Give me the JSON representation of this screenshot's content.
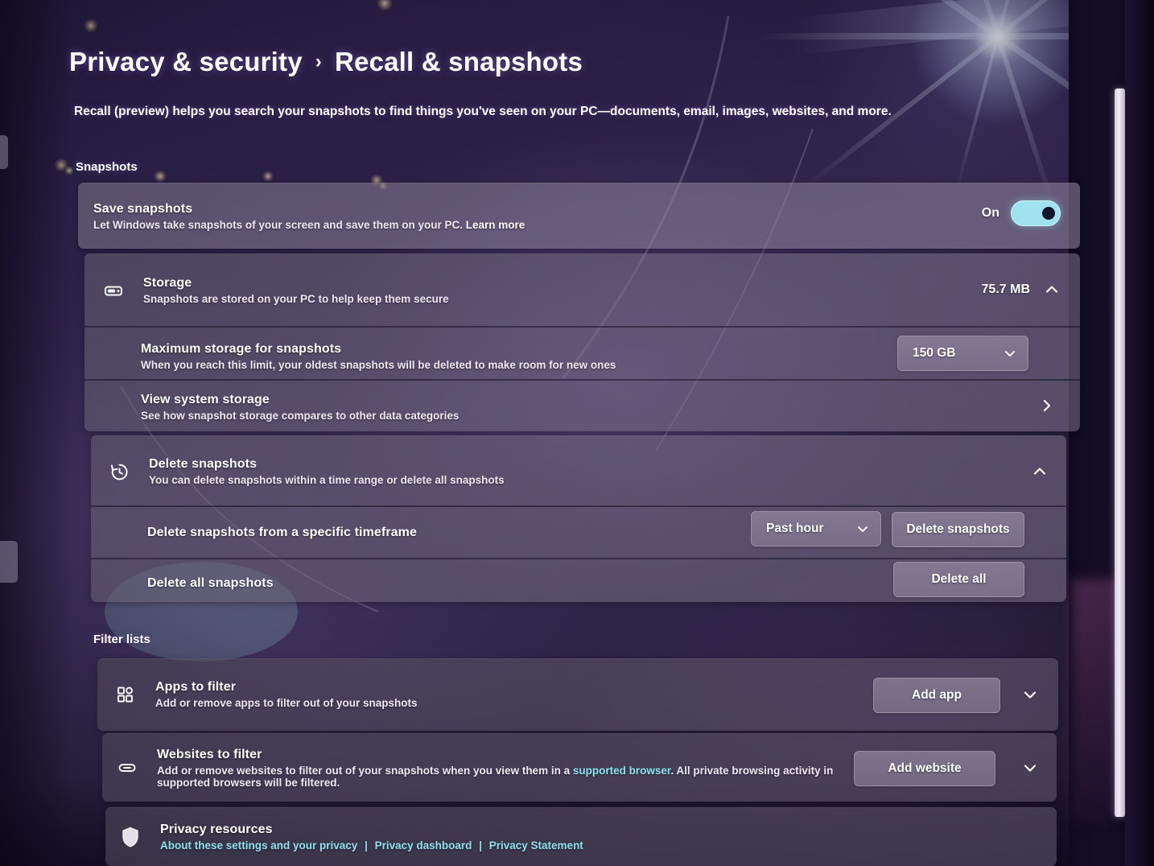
{
  "breadcrumb": {
    "parent": "Privacy & security",
    "separator": "›",
    "current": "Recall & snapshots"
  },
  "page": {
    "description": "Recall (preview) helps you search your snapshots to find things you've seen on your PC—documents, email, images, websites, and more."
  },
  "sections": {
    "snapshots_heading": "Snapshots",
    "filter_lists_heading": "Filter lists"
  },
  "save_snapshots": {
    "title": "Save snapshots",
    "subtitle_before_link": "Let Windows take snapshots of your screen and save them on your PC. ",
    "link_label": "Learn more",
    "toggle_state_label": "On",
    "toggle_on": true
  },
  "storage": {
    "title": "Storage",
    "subtitle": "Snapshots are stored on your PC to help keep them secure",
    "value": "75.7 MB",
    "expander_icon": "chevron-up-icon",
    "icon": "hard-drive-icon",
    "max_storage": {
      "title": "Maximum storage for snapshots",
      "subtitle": "When you reach this limit, your oldest snapshots will be deleted to make room for new ones",
      "selected": "150 GB",
      "chevron": "chevron-down-icon"
    },
    "view_system_storage": {
      "title": "View system storage",
      "subtitle": "See how snapshot storage compares to other data categories",
      "chevron": "chevron-right-icon"
    }
  },
  "delete_snapshots": {
    "title": "Delete snapshots",
    "subtitle": "You can delete snapshots within a time range or delete all snapshots",
    "icon": "history-icon",
    "expander_icon": "chevron-up-icon",
    "timeframe_row": {
      "title": "Delete snapshots from a specific timeframe",
      "selected": "Past hour",
      "chevron": "chevron-down-icon",
      "button": "Delete snapshots"
    },
    "delete_all_row": {
      "title": "Delete all snapshots",
      "button": "Delete all"
    }
  },
  "apps_to_filter": {
    "title": "Apps to filter",
    "subtitle": "Add or remove apps to filter out of your snapshots",
    "icon": "apps-grid-icon",
    "button": "Add app",
    "chevron": "chevron-down-icon"
  },
  "websites_to_filter": {
    "title": "Websites to filter",
    "subtitle_part1": "Add or remove websites to filter out of your snapshots when you view them in a ",
    "subtitle_link": "supported browser",
    "subtitle_part2": ". All private browsing activity in supported browsers will be filtered.",
    "icon": "link-icon",
    "button": "Add website",
    "chevron": "chevron-down-icon"
  },
  "privacy_resources": {
    "title": "Privacy resources",
    "icon": "shield-icon",
    "links": [
      "About these settings and your privacy",
      "Privacy dashboard",
      "Privacy Statement"
    ],
    "link_separator": "|"
  },
  "colors": {
    "accent_toggle": "#9fe3ee",
    "link": "#8fe3ef",
    "card": "#7c7490",
    "background": "#2a2046"
  }
}
